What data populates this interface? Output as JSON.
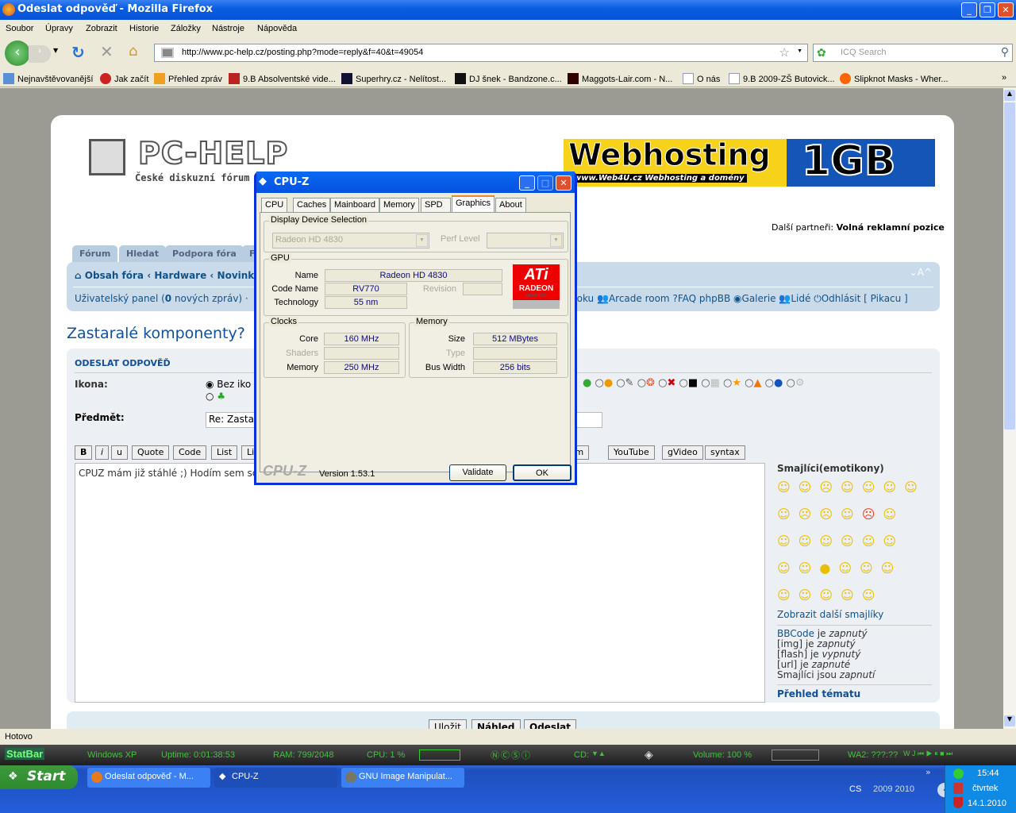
{
  "window": {
    "title": "Odeslat odpověď - Mozilla Firefox"
  },
  "menu": [
    "Soubor",
    "Úpravy",
    "Zobrazit",
    "Historie",
    "Záložky",
    "Nástroje",
    "Nápověda"
  ],
  "url": "http://www.pc-help.cz/posting.php?mode=reply&f=40&t=49054",
  "search_placeholder": "ICQ Search",
  "bookmarks": [
    "Nejnavštěvovanější",
    "Jak začít",
    "Přehled zpráv",
    "9.B Absolventské vide...",
    "Superhry.cz - Nelítost...",
    "DJ šnek - Bandzone.c...",
    "Maggots-Lair.com - N...",
    "O nás",
    "9.B 2009-ZŠ Butovick...",
    "Slipknot Masks - Wher..."
  ],
  "bookmarks_more": "»",
  "site": {
    "logo": "PC-HELP",
    "tagline": "České diskuzní fórum",
    "banner_main": "Webhosting",
    "banner_sub": "www.Web4U.cz  Webhosting a domény",
    "banner_size": "1GB",
    "partners_label": "Další partneři:",
    "partners_value": "Volná reklamní pozice",
    "tabs": [
      "Fórum",
      "Hledat",
      "Podpora fóra",
      "F"
    ],
    "breadcrumb": [
      "Obsah fóra",
      "Hardware",
      "Novinky"
    ],
    "font_size_ctrl": "⌄A^",
    "user_panel": "Uživatelský panel (",
    "new_count": "0",
    "user_panel_end": " nových zpráv) ·",
    "nav_links": [
      "doku",
      "Arcade room",
      "FAQ phpBB",
      "Galerie",
      "Lidé",
      "Odhlásit [ Pikacu ]"
    ],
    "topic_title": "Zastaralé komponenty?",
    "post_heading": "ODESLAT ODPOVĚĎ",
    "icon_label": "Ikona:",
    "no_icon": "Bez iko",
    "subject_label": "Předmět:",
    "subject_value": "Re: Zasta",
    "bbcode_buttons_left": [
      "B",
      "i",
      "u",
      "Quote",
      "Code",
      "List",
      "Li"
    ],
    "bbcode_buttons_right": [
      "eam",
      "YouTube",
      "gVideo",
      "syntax"
    ],
    "message": "CPUZ mám již stáhlé ;) Hodím sem sc",
    "smilies_title": "Smajlíci(emotikony)",
    "more_smilies": "Zobrazit další smajlíky",
    "options": [
      [
        "BBCode",
        " je ",
        "zapnutý"
      ],
      [
        "[img]",
        " je ",
        "zapnutý"
      ],
      [
        "[flash]",
        " je ",
        "vypnutý"
      ],
      [
        "[url]",
        " je ",
        "zapnuté"
      ],
      [
        "Smajlíci jsou",
        "",
        " zapnutí"
      ]
    ],
    "topic_review": "Přehled tématu",
    "buttons": [
      "Uložit",
      "Náhled",
      "Odeslat"
    ]
  },
  "cpuz": {
    "title": "CPU-Z",
    "tabs": [
      "CPU",
      "Caches",
      "Mainboard",
      "Memory",
      "SPD",
      "Graphics",
      "About"
    ],
    "active_tab": "Graphics",
    "display_group": "Display Device Selection",
    "device": "Radeon HD 4830",
    "perf_level_label": "Perf Level",
    "gpu_group": "GPU",
    "name_label": "Name",
    "name": "Radeon HD 4830",
    "code_label": "Code Name",
    "code": "RV770",
    "revision_label": "Revision",
    "tech_label": "Technology",
    "tech": "55 nm",
    "logo": "ATI RADEON GRAPHICS",
    "clocks_group": "Clocks",
    "core_label": "Core",
    "core": "160 MHz",
    "shaders_label": "Shaders",
    "mem_clk_label": "Memory",
    "mem_clk": "250 MHz",
    "memory_group": "Memory",
    "size_label": "Size",
    "size": "512 MBytes",
    "type_label": "Type",
    "bus_label": "Bus Width",
    "bus": "256 bits",
    "brand": "CPU-Z",
    "version": "Version 1.53.1",
    "validate": "Validate",
    "ok": "OK"
  },
  "status": "Hotovo",
  "statbar": {
    "brand": "StatBar",
    "os": "Windows XP",
    "uptime": "Uptime:  0:01:38:53",
    "ram": "RAM:  799/2048",
    "cpu": "CPU:   1 %",
    "cd": "CD:",
    "volume": "Volume:  100 %",
    "wa": "WA2: ???:??"
  },
  "taskbar": {
    "start": "Start",
    "tasks": [
      "Odeslat odpověď - M...",
      "CPU-Z",
      "GNU Image Manipulat..."
    ],
    "lang": "CS",
    "toolbar_years": "2009  2010",
    "time": "15:44",
    "day": "čtvrtek",
    "date": "14.1.2010"
  }
}
